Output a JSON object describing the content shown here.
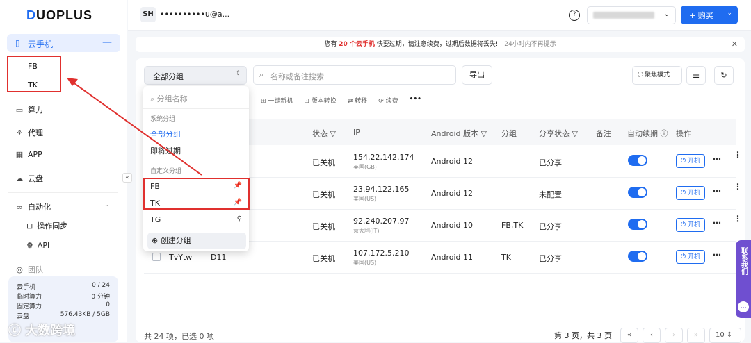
{
  "logo": "DUOPLUS",
  "sidebar": {
    "active": {
      "label": "云手机",
      "toggle": "—"
    },
    "subs": [
      "FB",
      "TK"
    ],
    "items": [
      {
        "label": "算力",
        "icon": "▭"
      },
      {
        "label": "代理",
        "icon": "⚘"
      },
      {
        "label": "APP",
        "icon": "▦"
      },
      {
        "label": "云盘",
        "icon": "☁"
      }
    ],
    "automation": {
      "label": "自动化",
      "icon": "∞"
    },
    "auto_subs": [
      {
        "label": "操作同步",
        "icon": "⊟"
      },
      {
        "label": "API",
        "icon": "⚙"
      }
    ],
    "team": "团队",
    "stats": [
      {
        "k": "云手机",
        "v": "0 / 24"
      },
      {
        "k": "临时算力",
        "v": "0 分钟"
      },
      {
        "k": "固定算力",
        "v": "0"
      },
      {
        "k": "云盘",
        "v": "576.43KB / 5GB"
      }
    ]
  },
  "topbar": {
    "avatar": "SH",
    "email": "••••••••••u@a...",
    "buy": "+ 购买"
  },
  "notice": {
    "pre": "您有",
    "count": "20 个云手机",
    "post": "快要过期，请注意续费，过期后数据将丢失!",
    "hide": "24小时内不再提示"
  },
  "filters": {
    "group_select": "全部分组",
    "search_placeholder": "名称或备注搜索",
    "export": "导出",
    "focus_mode": "聚焦模式"
  },
  "toolbar": [
    "⊞ 一键新机",
    "⊡ 版本转换",
    "⇄ 转移",
    "⟳ 续费",
    "•••"
  ],
  "table": {
    "headers": {
      "status": "状态 ▽",
      "ip": "IP",
      "android": "Android 版本 ▽",
      "group": "分组",
      "share": "分享状态 ▽",
      "note": "备注",
      "renew": "自动续期 ⓘ",
      "ops": "操作"
    },
    "rows": [
      {
        "name": "",
        "code": "",
        "status": "已关机",
        "ip": "154.22.142.174",
        "region": "英国(GB)",
        "android": "Android 12",
        "group": "",
        "share": "已分享"
      },
      {
        "name": "",
        "code": "",
        "status": "已关机",
        "ip": "23.94.122.165",
        "region": "美国(US)",
        "android": "Android 12",
        "group": "",
        "share": "未配置"
      },
      {
        "name": "",
        "code": "",
        "status": "已关机",
        "ip": "92.240.207.97",
        "region": "意大利(IT)",
        "android": "Android 10",
        "group": "FB,TK",
        "share": "已分享"
      },
      {
        "name": "TvYtw",
        "code": "D11",
        "status": "已关机",
        "ip": "107.172.5.210",
        "region": "美国(US)",
        "android": "Android 11",
        "group": "TK",
        "share": "已分享"
      }
    ],
    "boot": "⏻ 开机"
  },
  "footer": {
    "summary": "共 24 项，已选 0 项",
    "page": "第 3 页，共 3 页",
    "size": "10"
  },
  "dropdown": {
    "search_placeholder": "分组名称",
    "system_label": "系统分组",
    "system_items": [
      "全部分组",
      "即将过期"
    ],
    "custom_label": "自定义分组",
    "custom_items": [
      "FB",
      "TK",
      "TG"
    ],
    "create": "创建分组"
  },
  "contact": "联系我们",
  "watermark": "大数跨境"
}
